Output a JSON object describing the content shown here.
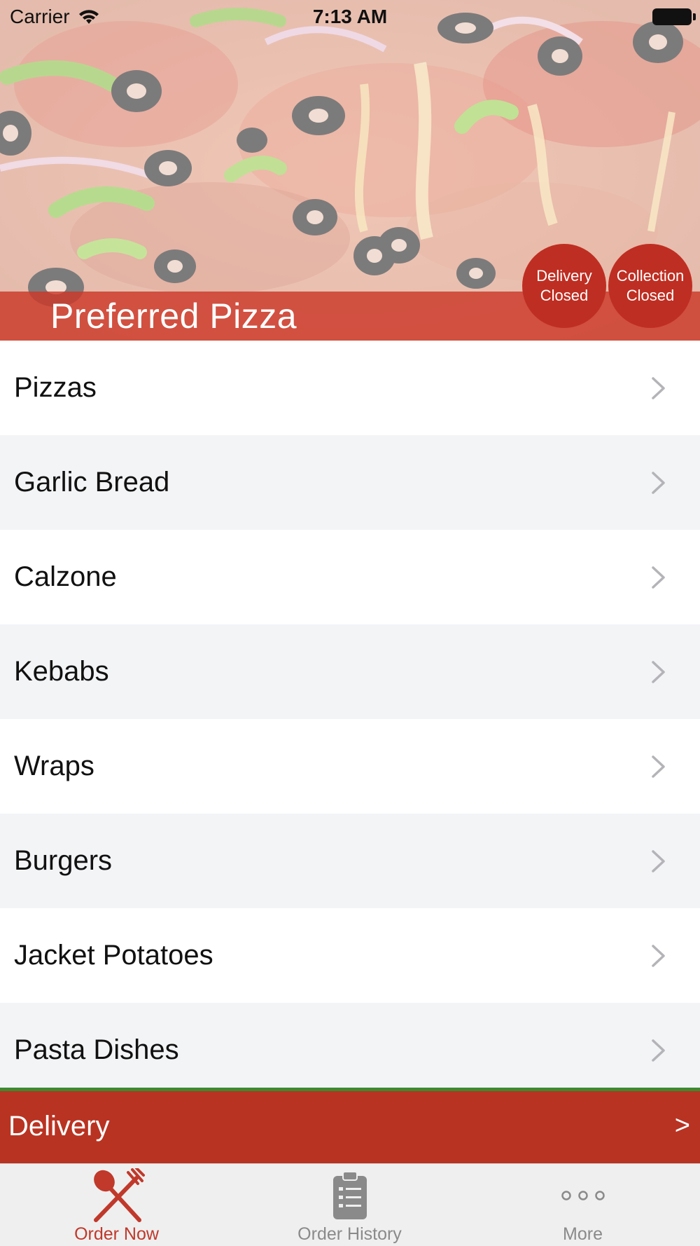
{
  "status_bar": {
    "carrier": "Carrier",
    "time": "7:13 AM"
  },
  "header": {
    "title": "Preferred Pizza",
    "delivery_badge": {
      "line1": "Delivery",
      "line2": "Closed"
    },
    "collection_badge": {
      "line1": "Collection",
      "line2": "Closed"
    }
  },
  "menu": {
    "items": [
      {
        "label": "Pizzas"
      },
      {
        "label": "Garlic Bread"
      },
      {
        "label": "Calzone"
      },
      {
        "label": "Kebabs"
      },
      {
        "label": "Wraps"
      },
      {
        "label": "Burgers"
      },
      {
        "label": "Jacket Potatoes"
      },
      {
        "label": "Pasta Dishes"
      }
    ]
  },
  "delivery_bar": {
    "label": "Delivery",
    "chevron": ">"
  },
  "tabbar": {
    "tabs": [
      {
        "label": "Order Now",
        "icon": "fork-knife-icon",
        "active": true
      },
      {
        "label": "Order History",
        "icon": "clipboard-icon",
        "active": false
      },
      {
        "label": "More",
        "icon": "more-dots-icon",
        "active": false
      }
    ]
  },
  "colors": {
    "brand_red": "#bf2e22",
    "delivery_bar": "#b93322",
    "accent_green": "#3a8a2e",
    "tab_inactive": "#8a8a8a"
  }
}
